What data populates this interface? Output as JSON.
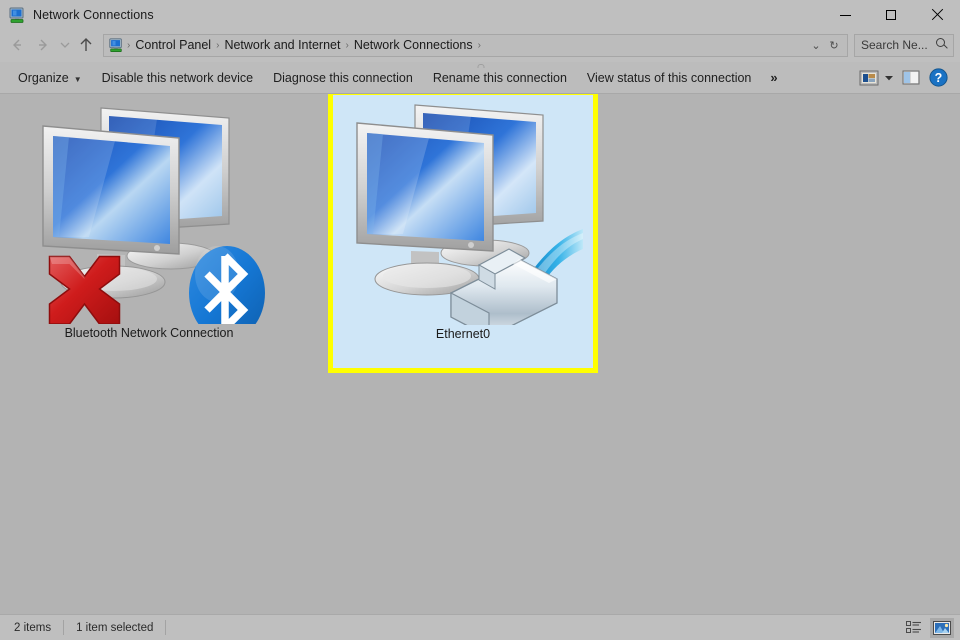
{
  "window": {
    "title": "Network Connections",
    "title_icon": "network-connection-icon",
    "controls": {
      "minimize": "Minimize",
      "maximize": "Maximize",
      "close": "Close"
    }
  },
  "addressbar": {
    "back": "Back",
    "forward": "Forward",
    "recent": "Recent locations",
    "up": "Up",
    "location_icon": "network-connection-icon",
    "breadcrumbs": [
      {
        "label": "Control Panel"
      },
      {
        "label": "Network and Internet"
      },
      {
        "label": "Network Connections"
      }
    ],
    "separator": "›",
    "history_dropdown": "⌄",
    "refresh": "↻",
    "search": {
      "value": "",
      "placeholder": "Search Ne...",
      "icon": "search-icon"
    }
  },
  "commandbar": {
    "items": [
      {
        "label": "Organize",
        "has_caret": true
      },
      {
        "label": "Disable this network device",
        "has_caret": false
      },
      {
        "label": "Diagnose this connection",
        "has_caret": false
      },
      {
        "label": "Rename this connection",
        "has_caret": false
      },
      {
        "label": "View status of this connection",
        "has_caret": false
      }
    ],
    "overflow": "»",
    "caret": "▼",
    "icons": {
      "change_view": "change-view-icon",
      "change_view_caret": "▼",
      "preview_pane": "preview-pane-icon",
      "help": "help-icon",
      "help_glyph": "?"
    }
  },
  "content": {
    "connections": [
      {
        "name": "Bluetooth Network Connection",
        "selected": false,
        "disabled": true,
        "badge": "bluetooth-icon",
        "status_overlay": "red-x-icon"
      },
      {
        "name": "Ethernet0",
        "selected": true,
        "disabled": false,
        "badge": "ethernet-cable-icon",
        "status_overlay": ""
      }
    ]
  },
  "statusbar": {
    "item_count": "2 items",
    "selection": "1 item selected",
    "views": {
      "details": "details-view-icon",
      "large_icons": "large-icons-view-icon"
    }
  },
  "colors": {
    "chrome": "#bfbfbf",
    "content_bg": "#b3b3b3",
    "selection_bg": "#cfe6f7",
    "selection_border": "#ffff00",
    "accent_blue": "#1c6fd0",
    "disabled_red": "#d21f1f"
  }
}
